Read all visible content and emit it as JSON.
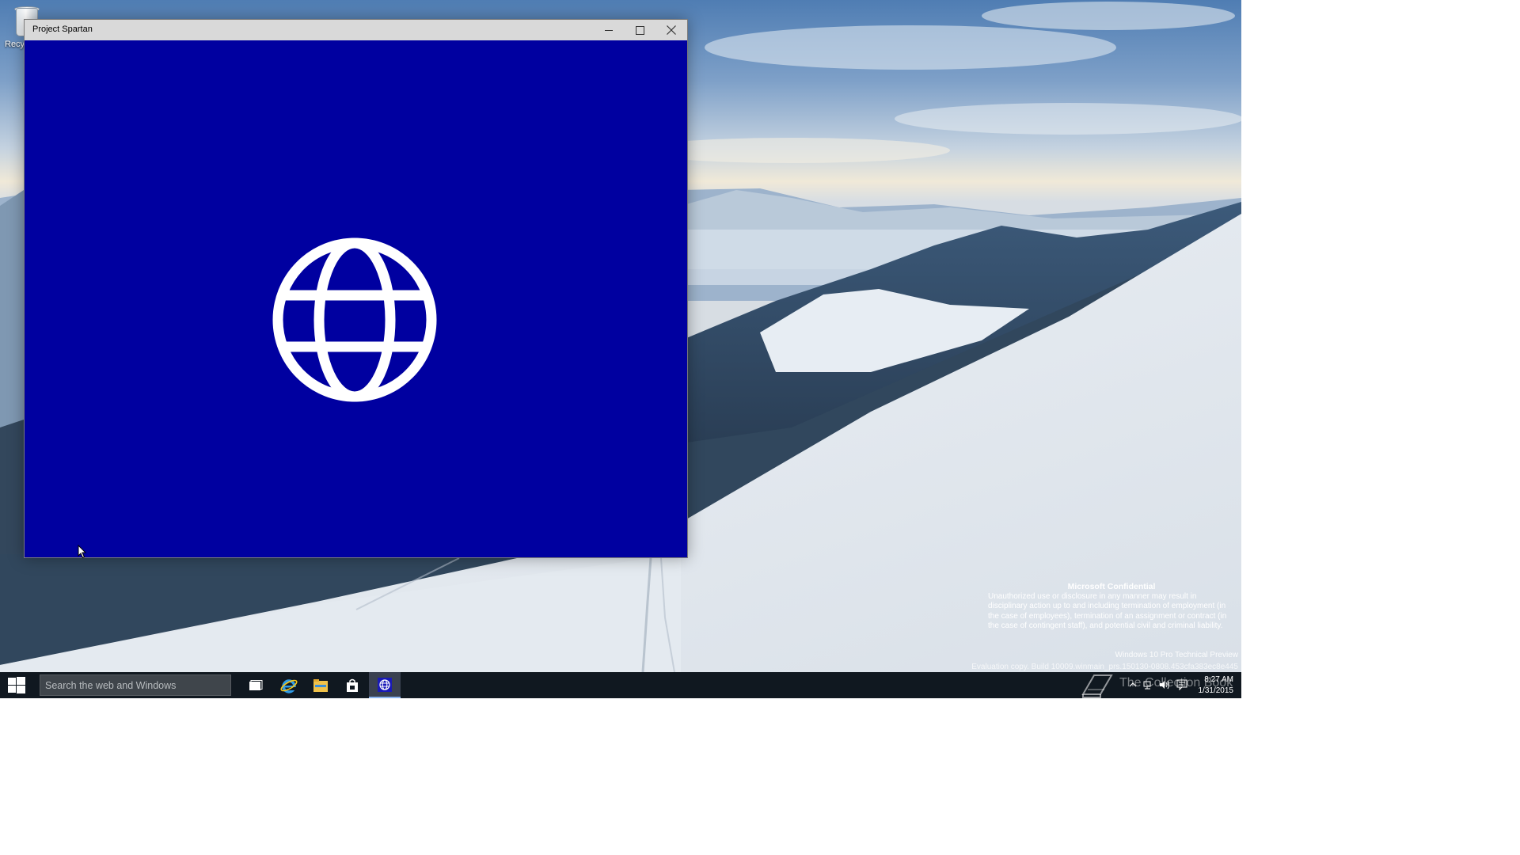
{
  "desktop": {
    "icons": [
      {
        "name": "recycle-bin",
        "label": "Recyc"
      }
    ],
    "watermark": {
      "heading": "Microsoft Confidential",
      "body": "Unauthorized use or disclosure in any manner may result in disciplinary action up to and including termination of employment (in the case of employees), termination of an assignment or contract (in the case of contingent staff), and potential civil and criminal liability.",
      "edition": "Windows 10 Pro Technical Preview",
      "build": "Evaluation copy. Build 10009.winmain_prs.150130-0808.453cfa383ec8e445"
    }
  },
  "window": {
    "title": "Project Spartan",
    "splash_background": "#0000a0",
    "splash_icon": "globe-icon",
    "controls": {
      "minimize": "minimize-icon",
      "maximize": "maximize-icon",
      "close": "close-icon"
    }
  },
  "taskbar": {
    "start_icon": "windows-logo-icon",
    "search": {
      "placeholder": "Search the web and Windows",
      "value": ""
    },
    "pinned": [
      "task-view-icon",
      "internet-explorer-icon",
      "file-explorer-icon",
      "store-icon",
      "project-spartan-icon"
    ],
    "active_app": "Project Spartan",
    "watermark_logo_text": "The Collection Book",
    "tray_icons": [
      "chevron-up-icon",
      "network-icon",
      "volume-icon",
      "action-center-icon"
    ],
    "clock": {
      "time": "8:27 AM",
      "date": "1/31/2015"
    }
  },
  "colors": {
    "taskbar": "#101820",
    "titlebar": "#d9d9d9",
    "accent": "#8ab4f0"
  }
}
